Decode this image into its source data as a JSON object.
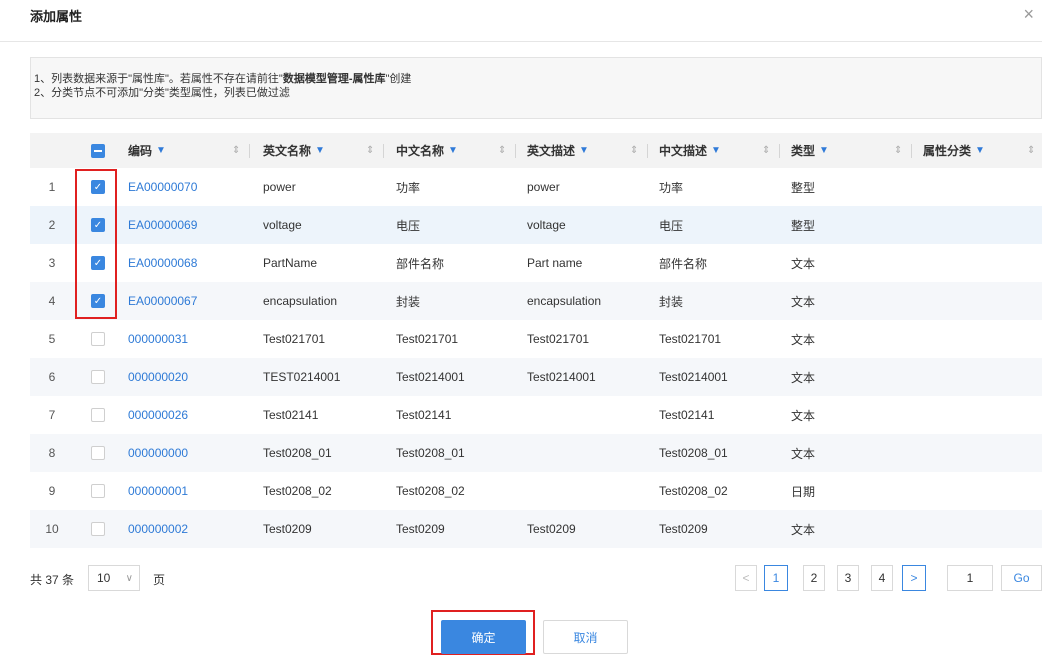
{
  "dialog": {
    "title": "添加属性",
    "close_icon": "×"
  },
  "notice": {
    "line1_prefix": "1、列表数据来源于\"属性库\"。若属性不存在请前往\"",
    "line1_emph": "数据模型管理-属性库",
    "line1_suffix": "\"创建",
    "line2": "2、分类节点不可添加\"分类\"类型属性，列表已做过滤"
  },
  "table": {
    "columns": {
      "code": "编码",
      "en_name": "英文名称",
      "cn_name": "中文名称",
      "en_desc": "英文描述",
      "cn_desc": "中文描述",
      "type": "类型",
      "category": "属性分类"
    },
    "header_checkbox_state": "indeterminate",
    "rows": [
      {
        "idx": "1",
        "checked": true,
        "code": "EA00000070",
        "en_name": "power",
        "cn_name": "功率",
        "en_desc": "power",
        "cn_desc": "功率",
        "type": "整型",
        "category": ""
      },
      {
        "idx": "2",
        "checked": true,
        "code": "EA00000069",
        "en_name": "voltage",
        "cn_name": "电压",
        "en_desc": "voltage",
        "cn_desc": "电压",
        "type": "整型",
        "category": ""
      },
      {
        "idx": "3",
        "checked": true,
        "code": "EA00000068",
        "en_name": "PartName",
        "cn_name": "部件名称",
        "en_desc": "Part name",
        "cn_desc": "部件名称",
        "type": "文本",
        "category": ""
      },
      {
        "idx": "4",
        "checked": true,
        "code": "EA00000067",
        "en_name": "encapsulation",
        "cn_name": "封装",
        "en_desc": "encapsulation",
        "cn_desc": "封装",
        "type": "文本",
        "category": ""
      },
      {
        "idx": "5",
        "checked": false,
        "code": "000000031",
        "en_name": "Test021701",
        "cn_name": "Test021701",
        "en_desc": "Test021701",
        "cn_desc": "Test021701",
        "type": "文本",
        "category": ""
      },
      {
        "idx": "6",
        "checked": false,
        "code": "000000020",
        "en_name": "TEST0214001",
        "cn_name": "Test0214001",
        "en_desc": "Test0214001",
        "cn_desc": "Test0214001",
        "type": "文本",
        "category": ""
      },
      {
        "idx": "7",
        "checked": false,
        "code": "000000026",
        "en_name": "Test02141",
        "cn_name": "Test02141",
        "en_desc": "",
        "cn_desc": "Test02141",
        "type": "文本",
        "category": ""
      },
      {
        "idx": "8",
        "checked": false,
        "code": "000000000",
        "en_name": "Test0208_01",
        "cn_name": "Test0208_01",
        "en_desc": "",
        "cn_desc": "Test0208_01",
        "type": "文本",
        "category": ""
      },
      {
        "idx": "9",
        "checked": false,
        "code": "000000001",
        "en_name": "Test0208_02",
        "cn_name": "Test0208_02",
        "en_desc": "",
        "cn_desc": "Test0208_02",
        "type": "日期",
        "category": ""
      },
      {
        "idx": "10",
        "checked": false,
        "code": "000000002",
        "en_name": "Test0209",
        "cn_name": "Test0209",
        "en_desc": "Test0209",
        "cn_desc": "Test0209",
        "type": "文本",
        "category": ""
      }
    ]
  },
  "pagination": {
    "total": "共 37 条",
    "page_size": "10",
    "page_unit": "页",
    "prev": "<",
    "pages": [
      "1",
      "2",
      "3",
      "4"
    ],
    "current_page": "1",
    "next": ">",
    "jump_value": "1",
    "go_label": "Go"
  },
  "actions": {
    "confirm": "确定",
    "cancel": "取消"
  },
  "colors": {
    "accent": "#3a87e0",
    "link": "#2e7ad6",
    "highlight_box": "#e02020"
  },
  "icons": {
    "filter": "funnel-icon",
    "sort": "sort-icon",
    "check": "check-icon",
    "close": "close-icon",
    "chevron": "chevron-down-icon"
  }
}
